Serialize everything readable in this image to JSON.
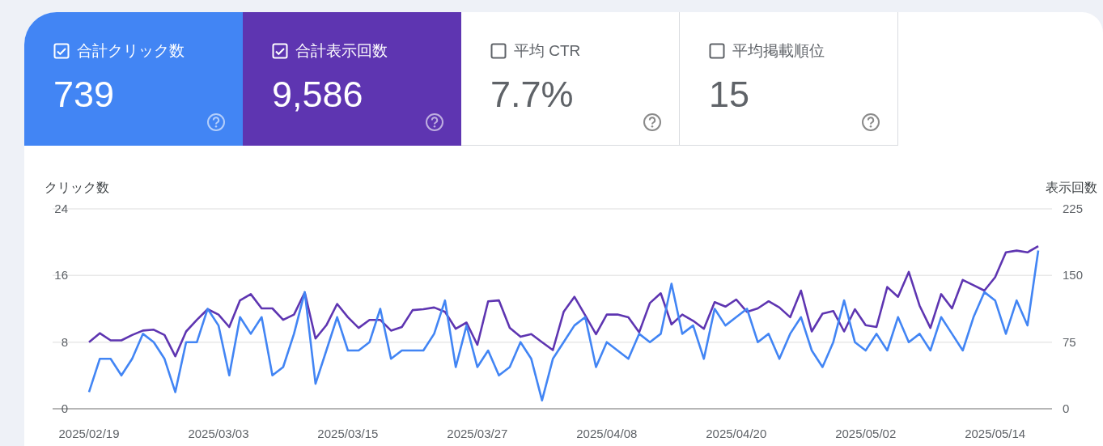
{
  "metrics": [
    {
      "label": "合計クリック数",
      "value": "739",
      "checked": true,
      "color": "#4285f4"
    },
    {
      "label": "合計表示回数",
      "value": "9,586",
      "checked": true,
      "color": "#5e35b1"
    },
    {
      "label": "平均 CTR",
      "value": "7.7%",
      "checked": false
    },
    {
      "label": "平均掲載順位",
      "value": "15",
      "checked": false
    }
  ],
  "chart": {
    "chart_data": {
      "type": "line",
      "ylabel": "クリック数",
      "y2label": "表示回数",
      "ylim": [
        0,
        24
      ],
      "y2lim": [
        0,
        225
      ],
      "yticks": [
        0,
        8,
        16,
        24
      ],
      "y2ticks": [
        0,
        75,
        150,
        225
      ],
      "categories": [
        "2025/02/19",
        null,
        null,
        null,
        null,
        null,
        null,
        null,
        null,
        null,
        null,
        null,
        "2025/03/03",
        null,
        null,
        null,
        null,
        null,
        null,
        null,
        null,
        null,
        null,
        null,
        "2025/03/15",
        null,
        null,
        null,
        null,
        null,
        null,
        null,
        null,
        null,
        null,
        null,
        "2025/03/27",
        null,
        null,
        null,
        null,
        null,
        null,
        null,
        null,
        null,
        null,
        null,
        "2025/04/08",
        null,
        null,
        null,
        null,
        null,
        null,
        null,
        null,
        null,
        null,
        null,
        "2025/04/20",
        null,
        null,
        null,
        null,
        null,
        null,
        null,
        null,
        null,
        null,
        null,
        "2025/05/02",
        null,
        null,
        null,
        null,
        null,
        null,
        null,
        null,
        null,
        null,
        null,
        "2025/05/14",
        null,
        null,
        null,
        null
      ],
      "series": [
        {
          "color": "#5e35b1",
          "axis": "y2",
          "values": [
            75,
            85,
            77,
            77,
            83,
            88,
            89,
            83,
            59,
            87,
            100,
            112,
            106,
            92,
            122,
            129,
            113,
            113,
            100,
            106,
            131,
            79,
            94,
            118,
            103,
            91,
            100,
            100,
            88,
            92,
            111,
            112,
            114,
            109,
            90,
            97,
            72,
            121,
            122,
            91,
            81,
            84,
            75,
            66,
            109,
            126,
            105,
            84,
            106,
            106,
            103,
            86,
            119,
            130,
            95,
            106,
            99,
            90,
            120,
            115,
            123,
            109,
            113,
            121,
            114,
            103,
            133,
            87,
            107,
            110,
            87,
            112,
            94,
            92,
            137,
            126,
            154,
            116,
            91,
            129,
            113,
            145,
            139,
            133,
            148,
            176,
            178,
            176,
            183
          ]
        },
        {
          "color": "#4285f4",
          "values": [
            2,
            6,
            6,
            4,
            6,
            9,
            8,
            6,
            2,
            8,
            8,
            12,
            10,
            4,
            11,
            9,
            11,
            4,
            5,
            9,
            14,
            3,
            7,
            11,
            7,
            7,
            8,
            12,
            6,
            7,
            7,
            7,
            9,
            13,
            5,
            10,
            5,
            7,
            4,
            5,
            8,
            6,
            1,
            6,
            8,
            10,
            11,
            5,
            8,
            7,
            6,
            9,
            8,
            9,
            15,
            9,
            10,
            6,
            12,
            10,
            11,
            12,
            8,
            9,
            6,
            9,
            11,
            7,
            5,
            8,
            13,
            8,
            7,
            9,
            7,
            11,
            8,
            9,
            7,
            11,
            9,
            7,
            11,
            14,
            13,
            9,
            13,
            10,
            19
          ]
        }
      ]
    }
  }
}
